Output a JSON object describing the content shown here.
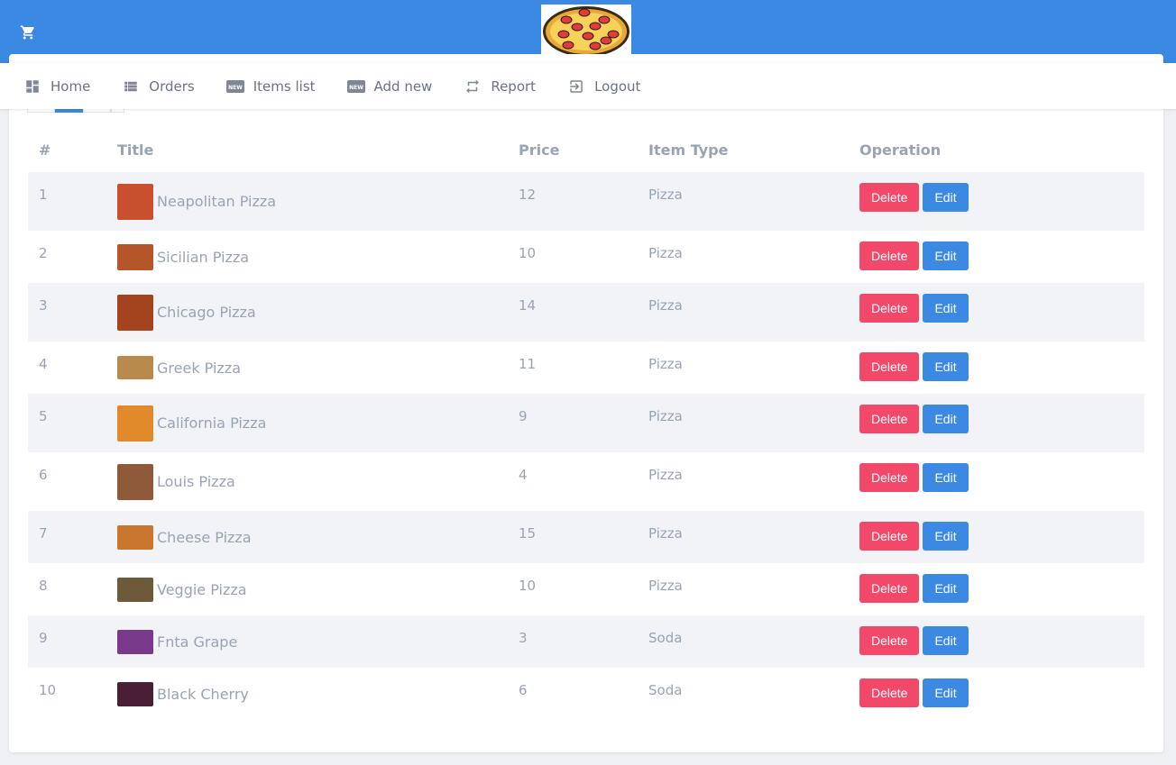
{
  "colors": {
    "topbar": "#3b89e3",
    "delete": "#f2496b",
    "edit": "#3b89e3"
  },
  "header": {
    "cart_icon": "cart-icon",
    "logo_icon": "pizza-logo"
  },
  "nav": [
    {
      "label": "Home",
      "icon": "dashboard-icon"
    },
    {
      "label": "Orders",
      "icon": "list-icon"
    },
    {
      "label": "Items list",
      "icon": "new-badge-icon"
    },
    {
      "label": "Add new",
      "icon": "new-badge-icon"
    },
    {
      "label": "Report",
      "icon": "swap-icon"
    },
    {
      "label": "Logout",
      "icon": "logout-icon"
    }
  ],
  "table": {
    "headers": [
      "#",
      "Title",
      "Price",
      "Item Type",
      "Operation"
    ],
    "delete_label": "Delete",
    "edit_label": "Edit",
    "rows": [
      {
        "num": "1",
        "title": "Neapolitan Pizza",
        "price": "12",
        "type": "Pizza",
        "thumb": "#c8502f"
      },
      {
        "num": "2",
        "title": "Sicilian Pizza",
        "price": "10",
        "type": "Pizza",
        "thumb": "#b5562a"
      },
      {
        "num": "3",
        "title": "Chicago Pizza",
        "price": "14",
        "type": "Pizza",
        "thumb": "#a3441f"
      },
      {
        "num": "4",
        "title": "Greek Pizza",
        "price": "11",
        "type": "Pizza",
        "thumb": "#b98a4e"
      },
      {
        "num": "5",
        "title": "California Pizza",
        "price": "9",
        "type": "Pizza",
        "thumb": "#e08a2c"
      },
      {
        "num": "6",
        "title": "Louis Pizza",
        "price": "4",
        "type": "Pizza",
        "thumb": "#8e5a3a"
      },
      {
        "num": "7",
        "title": "Cheese Pizza",
        "price": "15",
        "type": "Pizza",
        "thumb": "#c9772f"
      },
      {
        "num": "8",
        "title": "Veggie Pizza",
        "price": "10",
        "type": "Pizza",
        "thumb": "#6e5a3b"
      },
      {
        "num": "9",
        "title": "Fnta Grape",
        "price": "3",
        "type": "Soda",
        "thumb": "#7a3a8c"
      },
      {
        "num": "10",
        "title": "Black Cherry",
        "price": "6",
        "type": "Soda",
        "thumb": "#4a1f35"
      }
    ]
  }
}
